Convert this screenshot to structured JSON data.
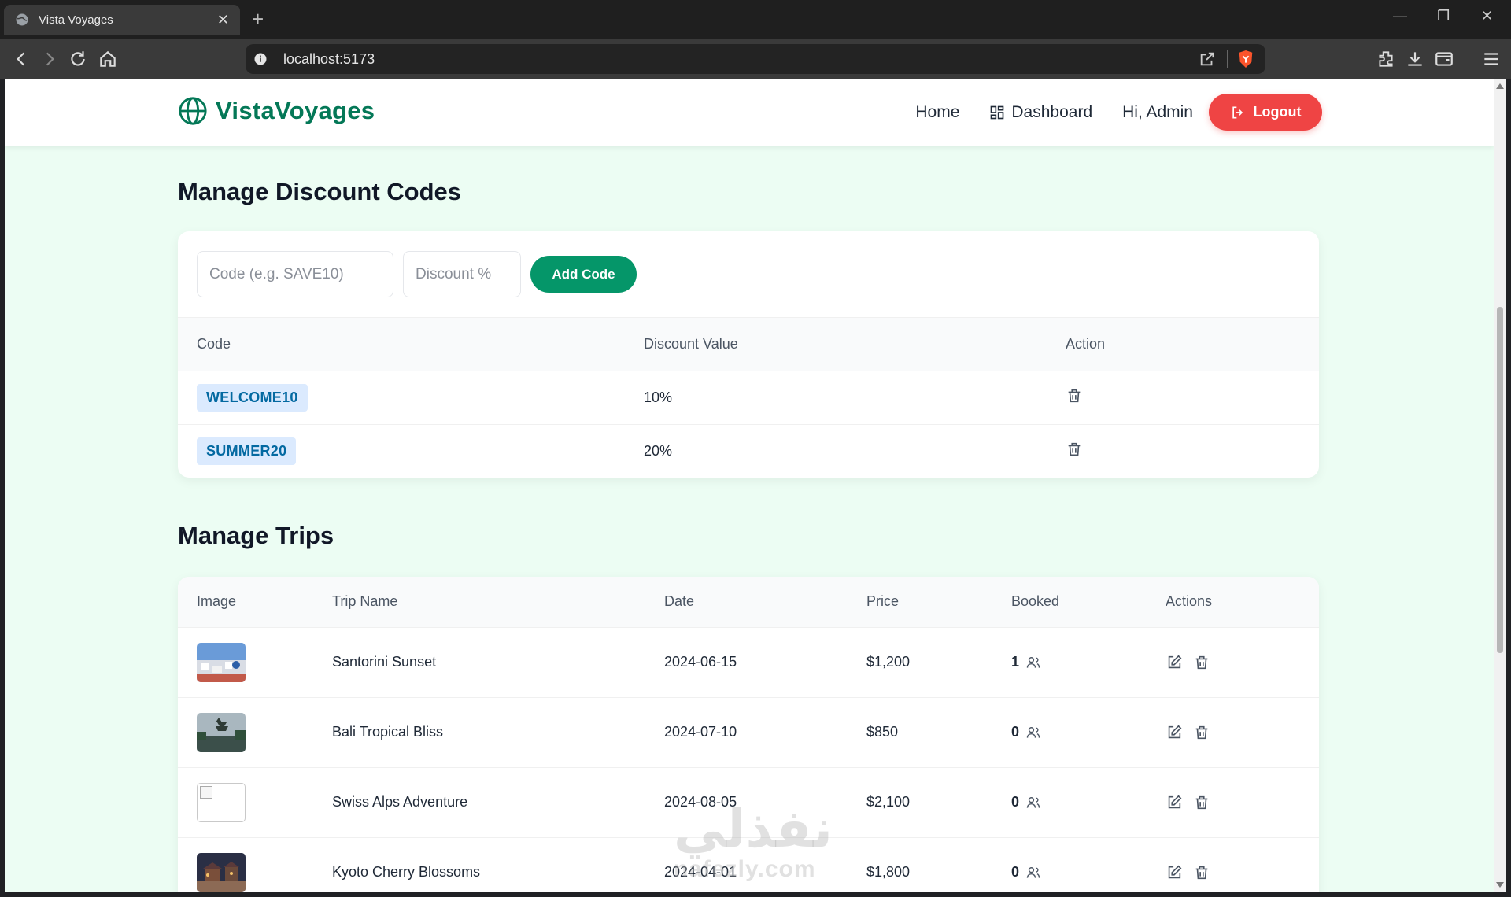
{
  "browser": {
    "tab_title": "Vista Voyages",
    "url": "localhost:5173"
  },
  "site": {
    "brand": "VistaVoyages",
    "nav": {
      "home": "Home",
      "dashboard": "Dashboard",
      "greeting": "Hi, Admin",
      "logout": "Logout"
    }
  },
  "discounts": {
    "title": "Manage Discount Codes",
    "code_placeholder": "Code (e.g. SAVE10)",
    "discount_placeholder": "Discount %",
    "add_label": "Add Code",
    "headers": [
      "Code",
      "Discount Value",
      "Action"
    ],
    "rows": [
      {
        "code": "WELCOME10",
        "value": "10%"
      },
      {
        "code": "SUMMER20",
        "value": "20%"
      }
    ]
  },
  "trips": {
    "title": "Manage Trips",
    "headers": [
      "Image",
      "Trip Name",
      "Date",
      "Price",
      "Booked",
      "Actions"
    ],
    "rows": [
      {
        "name": "Santorini Sunset",
        "date": "2024-06-15",
        "price": "$1,200",
        "booked": "1",
        "image": "santorini"
      },
      {
        "name": "Bali Tropical Bliss",
        "date": "2024-07-10",
        "price": "$850",
        "booked": "0",
        "image": "bali"
      },
      {
        "name": "Swiss Alps Adventure",
        "date": "2024-08-05",
        "price": "$2,100",
        "booked": "0",
        "image": "broken"
      },
      {
        "name": "Kyoto Cherry Blossoms",
        "date": "2024-04-01",
        "price": "$1,800",
        "booked": "0",
        "image": "kyoto"
      }
    ]
  },
  "watermark": {
    "arabic": "نفذلي",
    "latin": "nafezly.com"
  },
  "colors": {
    "brand": "#047857",
    "primary_button": "#059669",
    "logout": "#ef4444",
    "page_bg": "#ecfdf3"
  }
}
